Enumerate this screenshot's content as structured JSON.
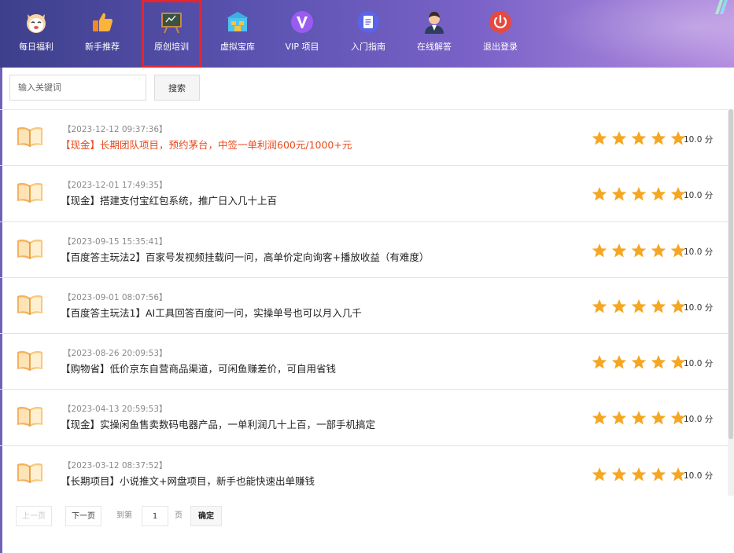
{
  "nav": {
    "items": [
      {
        "label": "每日福利",
        "icon": "cat-face-icon"
      },
      {
        "label": "新手推荐",
        "icon": "thumbs-up-icon"
      },
      {
        "label": "原创培训",
        "icon": "blackboard-icon",
        "active": true
      },
      {
        "label": "虚拟宝库",
        "icon": "storehouse-icon"
      },
      {
        "label": "VIP 项目",
        "icon": "vip-v-icon"
      },
      {
        "label": "入门指南",
        "icon": "guide-doc-icon"
      },
      {
        "label": "在线解答",
        "icon": "support-agent-icon"
      },
      {
        "label": "退出登录",
        "icon": "power-icon"
      }
    ]
  },
  "search": {
    "placeholder": "输入关键词",
    "button": "搜索"
  },
  "articles": [
    {
      "date": "【2023-12-12 09:37:36】",
      "title": "【现金】长期团队项目，预约茅台，中签一单利润600元/1000+元",
      "highlight": true,
      "rating": 5,
      "score": "10.0 分"
    },
    {
      "date": "【2023-12-01 17:49:35】",
      "title": "【现金】搭建支付宝红包系统，推广日入几十上百",
      "highlight": false,
      "rating": 5,
      "score": "10.0 分"
    },
    {
      "date": "【2023-09-15 15:35:41】",
      "title": "【百度答主玩法2】百家号发视频挂载问一问，高单价定向询客+播放收益（有难度）",
      "highlight": false,
      "rating": 5,
      "score": "10.0 分"
    },
    {
      "date": "【2023-09-01 08:07:56】",
      "title": "【百度答主玩法1】AI工具回答百度问一问，实操单号也可以月入几千",
      "highlight": false,
      "rating": 5,
      "score": "10.0 分"
    },
    {
      "date": "【2023-08-26 20:09:53】",
      "title": "【购物省】低价京东自营商品渠道，可闲鱼赚差价，可自用省钱",
      "highlight": false,
      "rating": 5,
      "score": "10.0 分"
    },
    {
      "date": "【2023-04-13 20:59:53】",
      "title": "【现金】实操闲鱼售卖数码电器产品，一单利润几十上百，一部手机搞定",
      "highlight": false,
      "rating": 5,
      "score": "10.0 分"
    },
    {
      "date": "【2023-03-12 08:37:52】",
      "title": "【长期项目】小说推文+网盘项目，新手也能快速出单赚钱",
      "highlight": false,
      "rating": 5,
      "score": "10.0 分"
    }
  ],
  "pager": {
    "prev": "上一页",
    "next": "下一页",
    "goto": "到第",
    "page": "1",
    "page_unit": "页",
    "confirm": "确定"
  },
  "colors": {
    "nav_start": "#3d3f8c",
    "nav_end": "#b58ee0",
    "highlight_title": "#e8491d",
    "star": "#f5a623",
    "active_border": "#e3262f"
  }
}
